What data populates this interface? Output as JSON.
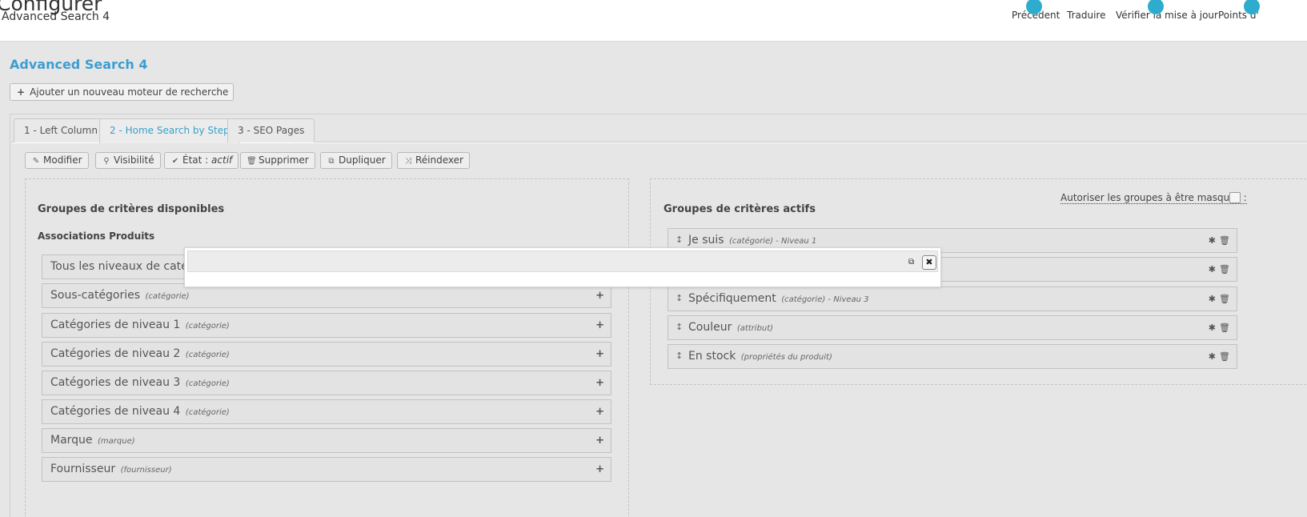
{
  "header": {
    "title": "Configurer",
    "subtitle": "Advanced Search 4",
    "toolbar": [
      {
        "label": "Précédent",
        "icon": "back-icon"
      },
      {
        "label": "Traduire",
        "icon": "flag-icon"
      },
      {
        "label": "Vérifier la mise à jour",
        "icon": "refresh-icon"
      },
      {
        "label": "Points d'",
        "icon": "anchor-icon"
      }
    ]
  },
  "module": {
    "title": "Advanced Search 4",
    "add_label": "Ajouter un nouveau moteur de recherche"
  },
  "tabs": [
    {
      "label": "1 - Left Column",
      "active": false
    },
    {
      "label": "2 - Home Search by Step",
      "active": true
    },
    {
      "label": "3 - SEO Pages",
      "active": false
    }
  ],
  "actions": {
    "edit": "Modifier",
    "visibility": "Visibilité",
    "state_label": "État :",
    "state_value": "actif",
    "delete": "Supprimer",
    "duplicate": "Dupliquer",
    "reindex": "Réindexer"
  },
  "available": {
    "title": "Groupes de critères disponibles",
    "subtitle": "Associations Produits",
    "items": [
      {
        "name": "Tous les niveaux de catég",
        "type": ""
      },
      {
        "name": "Sous-catégories",
        "type": "(catégorie)"
      },
      {
        "name": "Catégories de niveau 1",
        "type": "(catégorie)"
      },
      {
        "name": "Catégories de niveau 2",
        "type": "(catégorie)"
      },
      {
        "name": "Catégories de niveau 3",
        "type": "(catégorie)"
      },
      {
        "name": "Catégories de niveau 4",
        "type": "(catégorie)"
      },
      {
        "name": "Marque",
        "type": "(marque)"
      },
      {
        "name": "Fournisseur",
        "type": "(fournisseur)"
      }
    ]
  },
  "active": {
    "title": "Groupes de critères actifs",
    "allow_hide_label": "Autoriser les groupes à être masqués :",
    "items": [
      {
        "name": "Je suis",
        "type": "(catégorie) - Niveau 1"
      },
      {
        "name": "",
        "type": ""
      },
      {
        "name": "Spécifiquement",
        "type": "(catégorie) - Niveau 3"
      },
      {
        "name": "Couleur",
        "type": "(attribut)"
      },
      {
        "name": "En stock",
        "type": "(propriétés du produit)"
      }
    ]
  },
  "colors": {
    "accent": "#3d9dd1",
    "background": "#e6e6e6",
    "toolbar_icon": "#2eacce"
  }
}
